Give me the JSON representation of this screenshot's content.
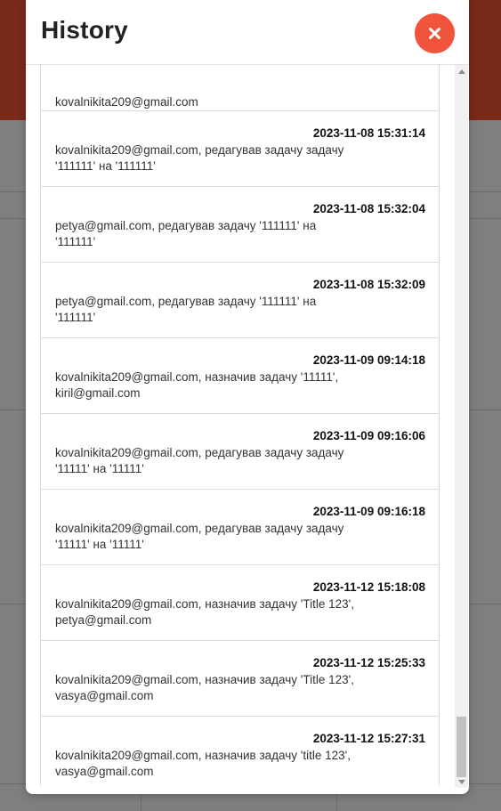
{
  "modal": {
    "title": "History",
    "close_icon": "close-icon"
  },
  "entries": [
    {
      "time": "",
      "text": "kovalnikita209@gmail.com"
    },
    {
      "time": "2023-11-08 15:31:14",
      "text": "kovalnikita209@gmail.com, редагував задачу задачу '111111' на '111111'"
    },
    {
      "time": "2023-11-08 15:32:04",
      "text": "petya@gmail.com, редагував задачу '111111' на '111111'"
    },
    {
      "time": "2023-11-08 15:32:09",
      "text": "petya@gmail.com, редагував задачу '111111' на '111111'"
    },
    {
      "time": "2023-11-09 09:14:18",
      "text": "kovalnikita209@gmail.com, назначив задачу '11111', kiril@gmail.com"
    },
    {
      "time": "2023-11-09 09:16:06",
      "text": "kovalnikita209@gmail.com, редагував задачу задачу '11111' на '11111'"
    },
    {
      "time": "2023-11-09 09:16:18",
      "text": "kovalnikita209@gmail.com, редагував задачу задачу '11111' на '11111'"
    },
    {
      "time": "2023-11-12 15:18:08",
      "text": "kovalnikita209@gmail.com, назначив задачу 'Title 123', petya@gmail.com"
    },
    {
      "time": "2023-11-12 15:25:33",
      "text": "kovalnikita209@gmail.com, назначив задачу 'Title 123', vasya@gmail.com"
    },
    {
      "time": "2023-11-12 15:27:31",
      "text": "kovalnikita209@gmail.com, назначив задачу 'title 123', vasya@gmail.com"
    }
  ],
  "colors": {
    "accent_close": "#f0543c",
    "backdrop": "#7f7f7f",
    "header_bg": "#7a2a19"
  }
}
